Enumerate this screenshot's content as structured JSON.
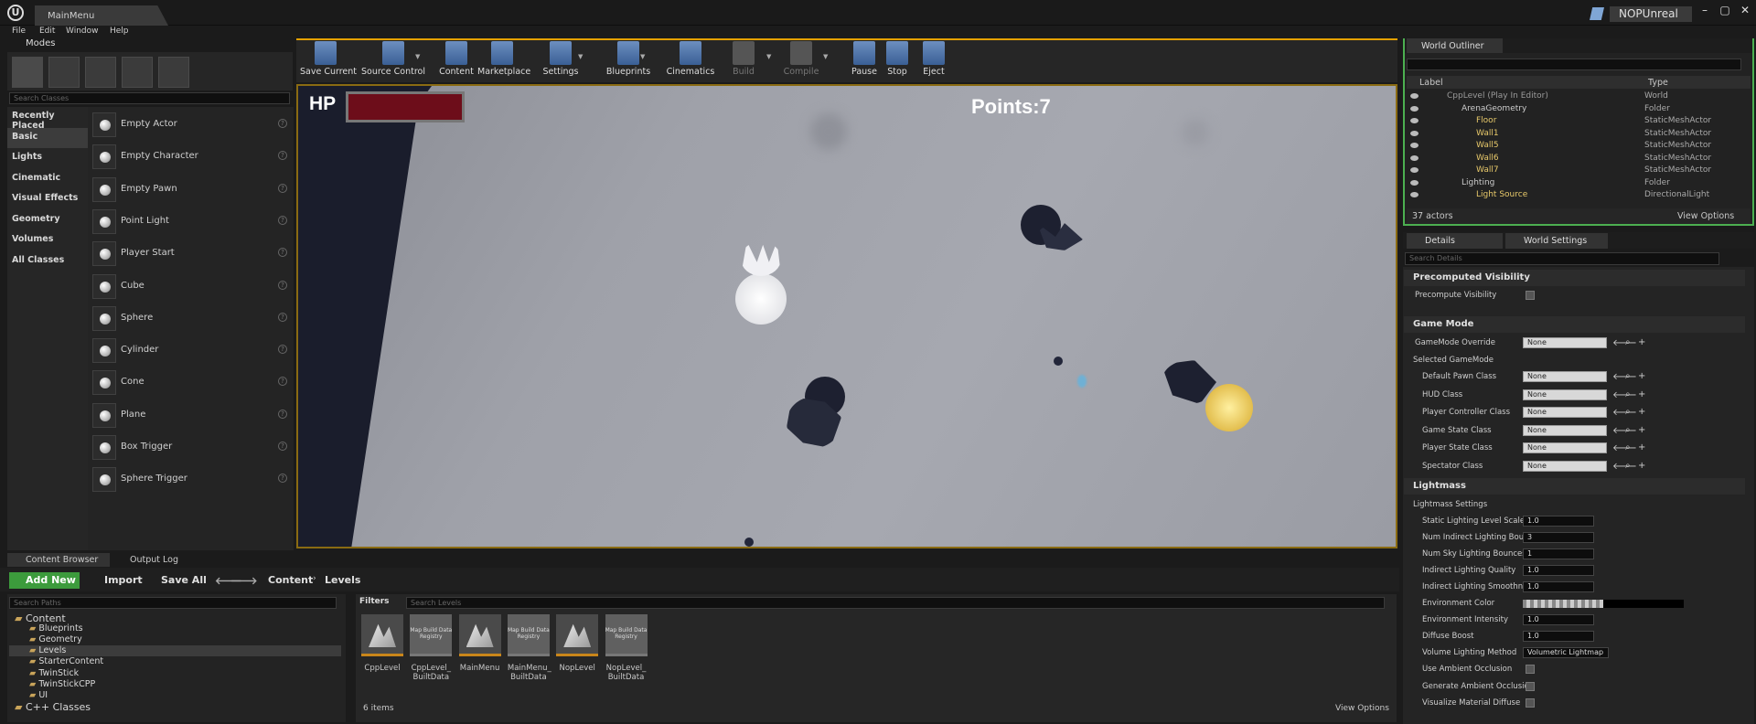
{
  "window": {
    "tab_title": "MainMenu",
    "project": "NOPUnreal"
  },
  "menu": [
    "File",
    "Edit",
    "Window",
    "Help"
  ],
  "modes": {
    "tab": "Modes",
    "search_placeholder": "Search Classes",
    "categories": [
      "Recently Placed",
      "Basic",
      "Lights",
      "Cinematic",
      "Visual Effects",
      "Geometry",
      "Volumes",
      "All Classes"
    ],
    "selected_category": "Basic",
    "items": [
      "Empty Actor",
      "Empty Character",
      "Empty Pawn",
      "Point Light",
      "Player Start",
      "Cube",
      "Sphere",
      "Cylinder",
      "Cone",
      "Plane",
      "Box Trigger",
      "Sphere Trigger"
    ]
  },
  "toolbar": [
    {
      "label": "Save Current",
      "icon": "save-icon"
    },
    {
      "label": "Source Control",
      "icon": "source-control-icon"
    },
    {
      "label": "Content",
      "icon": "content-icon"
    },
    {
      "label": "Marketplace",
      "icon": "marketplace-icon"
    },
    {
      "label": "Settings",
      "icon": "settings-icon"
    },
    {
      "label": "Blueprints",
      "icon": "blueprints-icon"
    },
    {
      "label": "Cinematics",
      "icon": "cinematics-icon"
    },
    {
      "label": "Build",
      "icon": "build-icon",
      "disabled": true
    },
    {
      "label": "Compile",
      "icon": "compile-icon",
      "disabled": true
    },
    {
      "label": "Pause",
      "icon": "pause-icon"
    },
    {
      "label": "Stop",
      "icon": "stop-icon"
    },
    {
      "label": "Eject",
      "icon": "eject-icon"
    }
  ],
  "game_hud": {
    "hp_label": "HP",
    "points_text": "Points:7"
  },
  "outliner": {
    "tab": "World Outliner",
    "col_label": "Label",
    "col_type": "Type",
    "rows": [
      {
        "label": "CppLevel (Play In Editor)",
        "type": "World",
        "indent": 0
      },
      {
        "label": "ArenaGeometry",
        "type": "Folder",
        "indent": 1
      },
      {
        "label": "Floor",
        "type": "StaticMeshActor",
        "indent": 2
      },
      {
        "label": "Wall1",
        "type": "StaticMeshActor",
        "indent": 2
      },
      {
        "label": "Wall5",
        "type": "StaticMeshActor",
        "indent": 2
      },
      {
        "label": "Wall6",
        "type": "StaticMeshActor",
        "indent": 2
      },
      {
        "label": "Wall7",
        "type": "StaticMeshActor",
        "indent": 2
      },
      {
        "label": "Lighting",
        "type": "Folder",
        "indent": 1
      },
      {
        "label": "Light Source",
        "type": "DirectionalLight",
        "indent": 2
      }
    ],
    "actor_count": "37 actors",
    "view_options": "View Options"
  },
  "details": {
    "tabs": [
      "Details",
      "World Settings"
    ],
    "search_placeholder": "Search Details",
    "sections": {
      "precomputed": {
        "title": "Precomputed Visibility",
        "prop": "Precompute Visibility"
      },
      "gamemode": {
        "title": "Game Mode",
        "override_label": "GameMode Override",
        "override_value": "None",
        "selected_label": "Selected GameMode",
        "props": [
          {
            "label": "Default Pawn Class",
            "value": "None"
          },
          {
            "label": "HUD Class",
            "value": "None"
          },
          {
            "label": "Player Controller Class",
            "value": "None"
          },
          {
            "label": "Game State Class",
            "value": "None"
          },
          {
            "label": "Player State Class",
            "value": "None"
          },
          {
            "label": "Spectator Class",
            "value": "None"
          }
        ]
      },
      "lightmass": {
        "title": "Lightmass",
        "sub": "Lightmass Settings",
        "props": [
          {
            "label": "Static Lighting Level Scale",
            "value": "1.0"
          },
          {
            "label": "Num Indirect Lighting Bounces",
            "value": "3"
          },
          {
            "label": "Num Sky Lighting Bounces",
            "value": "1"
          },
          {
            "label": "Indirect Lighting Quality",
            "value": "1.0"
          },
          {
            "label": "Indirect Lighting Smoothness",
            "value": "1.0"
          }
        ],
        "env_color_label": "Environment Color",
        "env_intensity_label": "Environment Intensity",
        "env_intensity_value": "1.0",
        "diffuse_label": "Diffuse Boost",
        "diffuse_value": "1.0",
        "volume_label": "Volume Lighting Method",
        "volume_value": "Volumetric Lightmap",
        "checks": [
          "Use Ambient Occlusion",
          "Generate Ambient Occlusion",
          "Visualize Material Diffuse"
        ]
      }
    }
  },
  "content_browser": {
    "tabs": [
      "Content Browser",
      "Output Log"
    ],
    "add_new": "Add New",
    "import": "Import",
    "save_all": "Save All",
    "breadcrumb": [
      "Content",
      "Levels"
    ],
    "path_placeholder": "Search Paths",
    "tree": [
      {
        "label": "Content",
        "indent": 0
      },
      {
        "label": "Blueprints",
        "indent": 1
      },
      {
        "label": "Geometry",
        "indent": 1
      },
      {
        "label": "Levels",
        "indent": 1
      },
      {
        "label": "StarterContent",
        "indent": 1
      },
      {
        "label": "TwinStick",
        "indent": 1
      },
      {
        "label": "TwinStickCPP",
        "indent": 1
      },
      {
        "label": "UI",
        "indent": 1
      },
      {
        "label": "C++ Classes",
        "indent": 0
      }
    ],
    "selected_folder": "Levels",
    "filters": "Filters",
    "asset_placeholder": "Search Levels",
    "assets": [
      {
        "name": "CppLevel",
        "kind": "map"
      },
      {
        "name": "CppLevel_ BuiltData",
        "kind": "registry"
      },
      {
        "name": "MainMenu",
        "kind": "map"
      },
      {
        "name": "MainMenu_ BuiltData",
        "kind": "registry"
      },
      {
        "name": "NopLevel",
        "kind": "map"
      },
      {
        "name": "NopLevel_ BuiltData",
        "kind": "registry"
      }
    ],
    "registry_caption": "Map Build Data Registry",
    "item_count": "6 items",
    "view_options": "View Options"
  }
}
